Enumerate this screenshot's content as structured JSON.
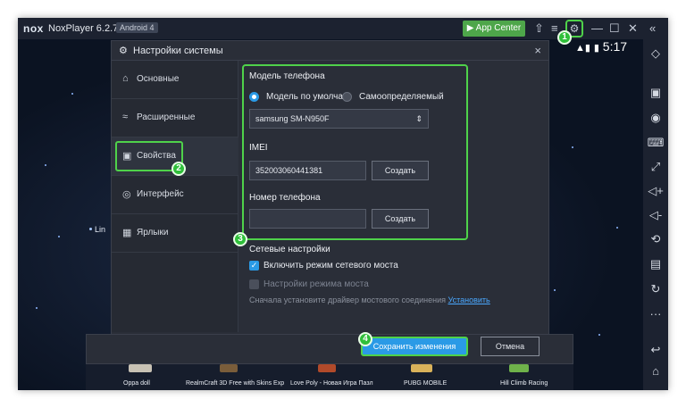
{
  "titlebar": {
    "logo": "nox",
    "version": "NoxPlayer 6.2.7.0",
    "android": "Android 4",
    "app_center": "App Center",
    "icons": [
      "shirt-icon",
      "menu-icon",
      "gear-icon",
      "minimize-icon",
      "restore-icon",
      "close-icon",
      "collapse-icon"
    ]
  },
  "status": {
    "time": "5:17"
  },
  "background_label": "Lin",
  "dialog": {
    "title": "Настройки системы",
    "close": "×",
    "sidebar": [
      {
        "label": "Основные",
        "icon": "home-icon"
      },
      {
        "label": "Расширенные",
        "icon": "sliders-icon"
      },
      {
        "label": "Свойства",
        "icon": "properties-icon"
      },
      {
        "label": "Интерфейс",
        "icon": "palette-icon"
      },
      {
        "label": "Ярлыки",
        "icon": "keyboard-icon"
      }
    ],
    "phone_model": {
      "title": "Модель телефона",
      "radio_default": "Модель по умолчан",
      "radio_custom": "Самоопределяемый",
      "model_value": "samsung SM-N950F"
    },
    "imei": {
      "title": "IMEI",
      "value": "352003060441381",
      "generate": "Создать"
    },
    "phone_number": {
      "title": "Номер телефона",
      "value": "",
      "generate": "Создать"
    },
    "network": {
      "title": "Сетевые настройки",
      "bridge_mode": "Включить режим сетевого моста",
      "bridge_settings": "Настройки режима моста",
      "hint": "Сначала установите драйвер мостового соединения",
      "install_link": "Установить"
    },
    "save": "Сохранить изменения",
    "cancel": "Отмена"
  },
  "apps": [
    "Oppa doll",
    "RealmCraft 3D Free with Skins Exp",
    "Love Poly - Новая Игра Пазл",
    "PUBG MOBILE",
    "Hill Climb Racing"
  ],
  "badges": [
    "1",
    "2",
    "3",
    "4"
  ],
  "colors": {
    "accent": "#2a9ae6",
    "highlight": "#4fd24a",
    "app_center": "#4ea64a"
  }
}
